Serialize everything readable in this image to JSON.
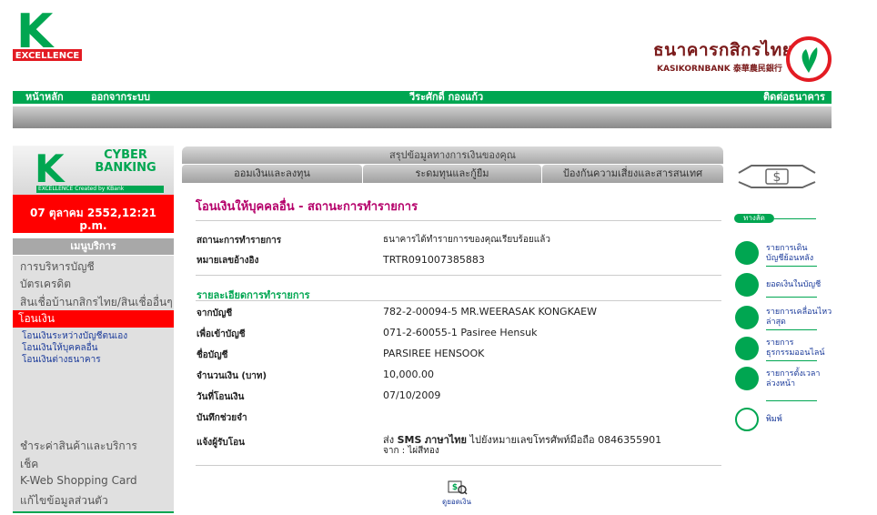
{
  "header": {
    "logo_letter": "K",
    "logo_word": "EXCELLENCE",
    "bank_name_th": "ธนาคารกสิกรไทย",
    "bank_name_en": "KASIKORNBANK 泰華農民銀行"
  },
  "nav": {
    "home": "หน้าหลัก",
    "logout": "ออกจากระบบ",
    "user": "วีระศักดิ์ กองแก้ว",
    "contact": "ติดต่อธนาคาร"
  },
  "left": {
    "cyber_line1": "CYBER",
    "cyber_line2": "BANKING",
    "strip": "EXCELLENCE Created by KBank",
    "date": "07 ตุลาคม 2552,12:21",
    "time_suffix": "p.m.",
    "menu_title": "เมนูบริการ",
    "menu_items": [
      "การบริหารบัญชี",
      "บัตรเครดิต",
      "สินเชื่อบ้านกสิกรไทย/สินเชื่ออื่นๆ"
    ],
    "active_item": "โอนเงิน",
    "sub_items": [
      "โอนเงินระหว่างบัญชีตนเอง",
      "โอนเงินให้บุคคลอื่น",
      "โอนเงินต่างธนาคาร"
    ],
    "bottom_items": [
      "ชำระค่าสินค้าและบริการ",
      "เช็ค",
      "K-Web Shopping Card",
      "แก้ไขข้อมูลส่วนตัว"
    ]
  },
  "tabs": {
    "top": "สรุปข้อมูลทางการเงินของคุณ",
    "items": [
      "ออมเงินและลงทุน",
      "ระดมทุนและกู้ยืม",
      "ป้องกันความเสี่ยงและสารสนเทศ"
    ]
  },
  "content": {
    "title": "โอนเงินให้บุคคลอื่น - สถานะการทำรายการ",
    "status_label": "สถานะการทำรายการ",
    "status_value": "ธนาคารได้ทำรายการของคุณเรียบร้อยแล้ว",
    "ref_label": "หมายเลขอ้างอิง",
    "ref_value": "TRTR091007385883",
    "section_title": "รายละเอียดการทำรายการ",
    "from_label": "จากบัญชี",
    "from_value": "782-2-00094-5 MR.WEERASAK KONGKAEW",
    "to_label": "เพื่อเข้าบัญชี",
    "to_value": "071-2-60055-1 Pasiree Hensuk",
    "name_label": "ชื่อบัญชี",
    "name_value": "PARSIREE HENSOOK",
    "amount_label": "จำนวนเงิน (บาท)",
    "amount_value": "10,000.00",
    "date_label": "วันที่โอนเงิน",
    "date_value": "07/10/2009",
    "memo_label": "บันทึกช่วยจำ",
    "notify_label": "แจ้งผู้รับโอน",
    "notify_prefix": "ส่ง",
    "notify_sms": "SMS",
    "notify_lang": "ภาษาไทย",
    "notify_rest": "ไปยังหมายเลขโทรศัพท์มือถือ 0846355901",
    "notify_from": "จาก : ไผ่สีทอง",
    "print_label": "ดูยอดเงิน"
  },
  "right": {
    "shortcut_title": "ทางลัด",
    "links": [
      {
        "l1": "รายการเดินบัญชีย้อนหลัง",
        "l2": ""
      },
      {
        "l1": "ยอดเงินในบัญชี",
        "l2": ""
      },
      {
        "l1": "รายการเคลื่อนไหว",
        "l2": "ล่าสุด"
      },
      {
        "l1": "รายการ",
        "l2": "ธุรกรรมออนไลน์"
      },
      {
        "l1": "รายการตั้งเวลา",
        "l2": "ล่วงหน้า"
      }
    ],
    "print": "พิมพ์"
  },
  "colors": {
    "green": "#00a651",
    "red": "#ff0000",
    "title_magenta": "#b5006a",
    "link_blue": "#1a3a9a"
  }
}
